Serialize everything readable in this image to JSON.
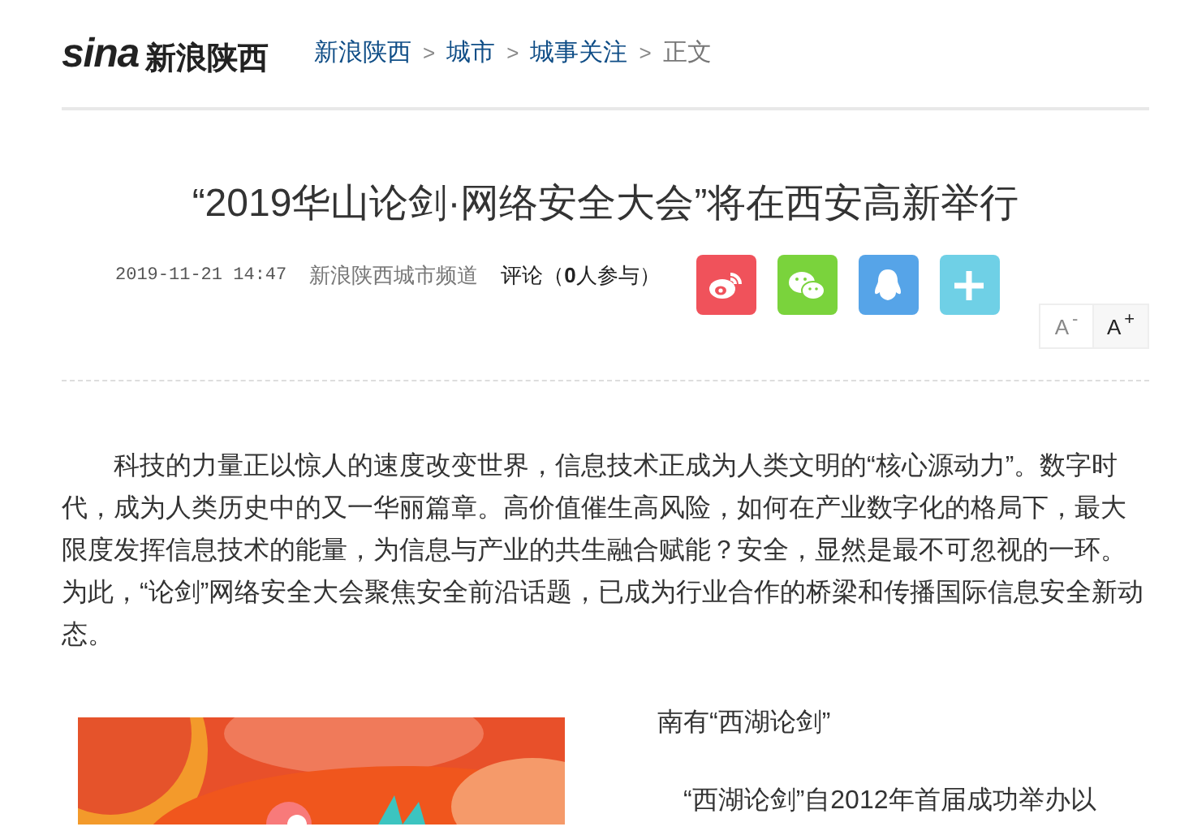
{
  "header": {
    "logo": {
      "mark": "sina",
      "name": "新浪陕西"
    },
    "breadcrumb": [
      {
        "label": "新浪陕西",
        "kind": "link"
      },
      {
        "label": "城市",
        "kind": "link"
      },
      {
        "label": "城事关注",
        "kind": "link"
      },
      {
        "label": "正文",
        "kind": "current"
      }
    ],
    "separator": ">"
  },
  "article": {
    "title": "“2019华山论剑·网络安全大会”将在西安高新举行",
    "date": "2019-11-21 14:47",
    "source": "新浪陕西城市频道",
    "comments": "评论（**0**人参与）",
    "share": [
      {
        "kind": "weibo",
        "color": "#f0525b"
      },
      {
        "kind": "wechat",
        "color": "#7ad33c"
      },
      {
        "kind": "qq",
        "color": "#56a4e8"
      },
      {
        "kind": "more",
        "color": "#6fd0e6"
      }
    ],
    "font_size": [
      {
        "label": "A",
        "sign": "-"
      },
      {
        "label": "A",
        "sign": "+"
      }
    ],
    "paragraph": "科技的力量正以惊人的速度改变世界，信息技术正成为人类文明的“核心源动力”。数字时代，成为人类历史中的又一华丽篇章。高价值催生高风险，如何在产业数字化的格局下，最大限度发挥信息技术的能量，为信息与产业的共生融合赋能？安全，显然是最不可忽视的一环。为此，“论剑”网络安全大会聚焦安全前沿话题，已成为行业合作的桥梁和传播国际信息安全新动态。",
    "side_heading": "南有“西湖论剑”",
    "side_text": "“西湖论剑”自2012年首届成功举办以"
  }
}
